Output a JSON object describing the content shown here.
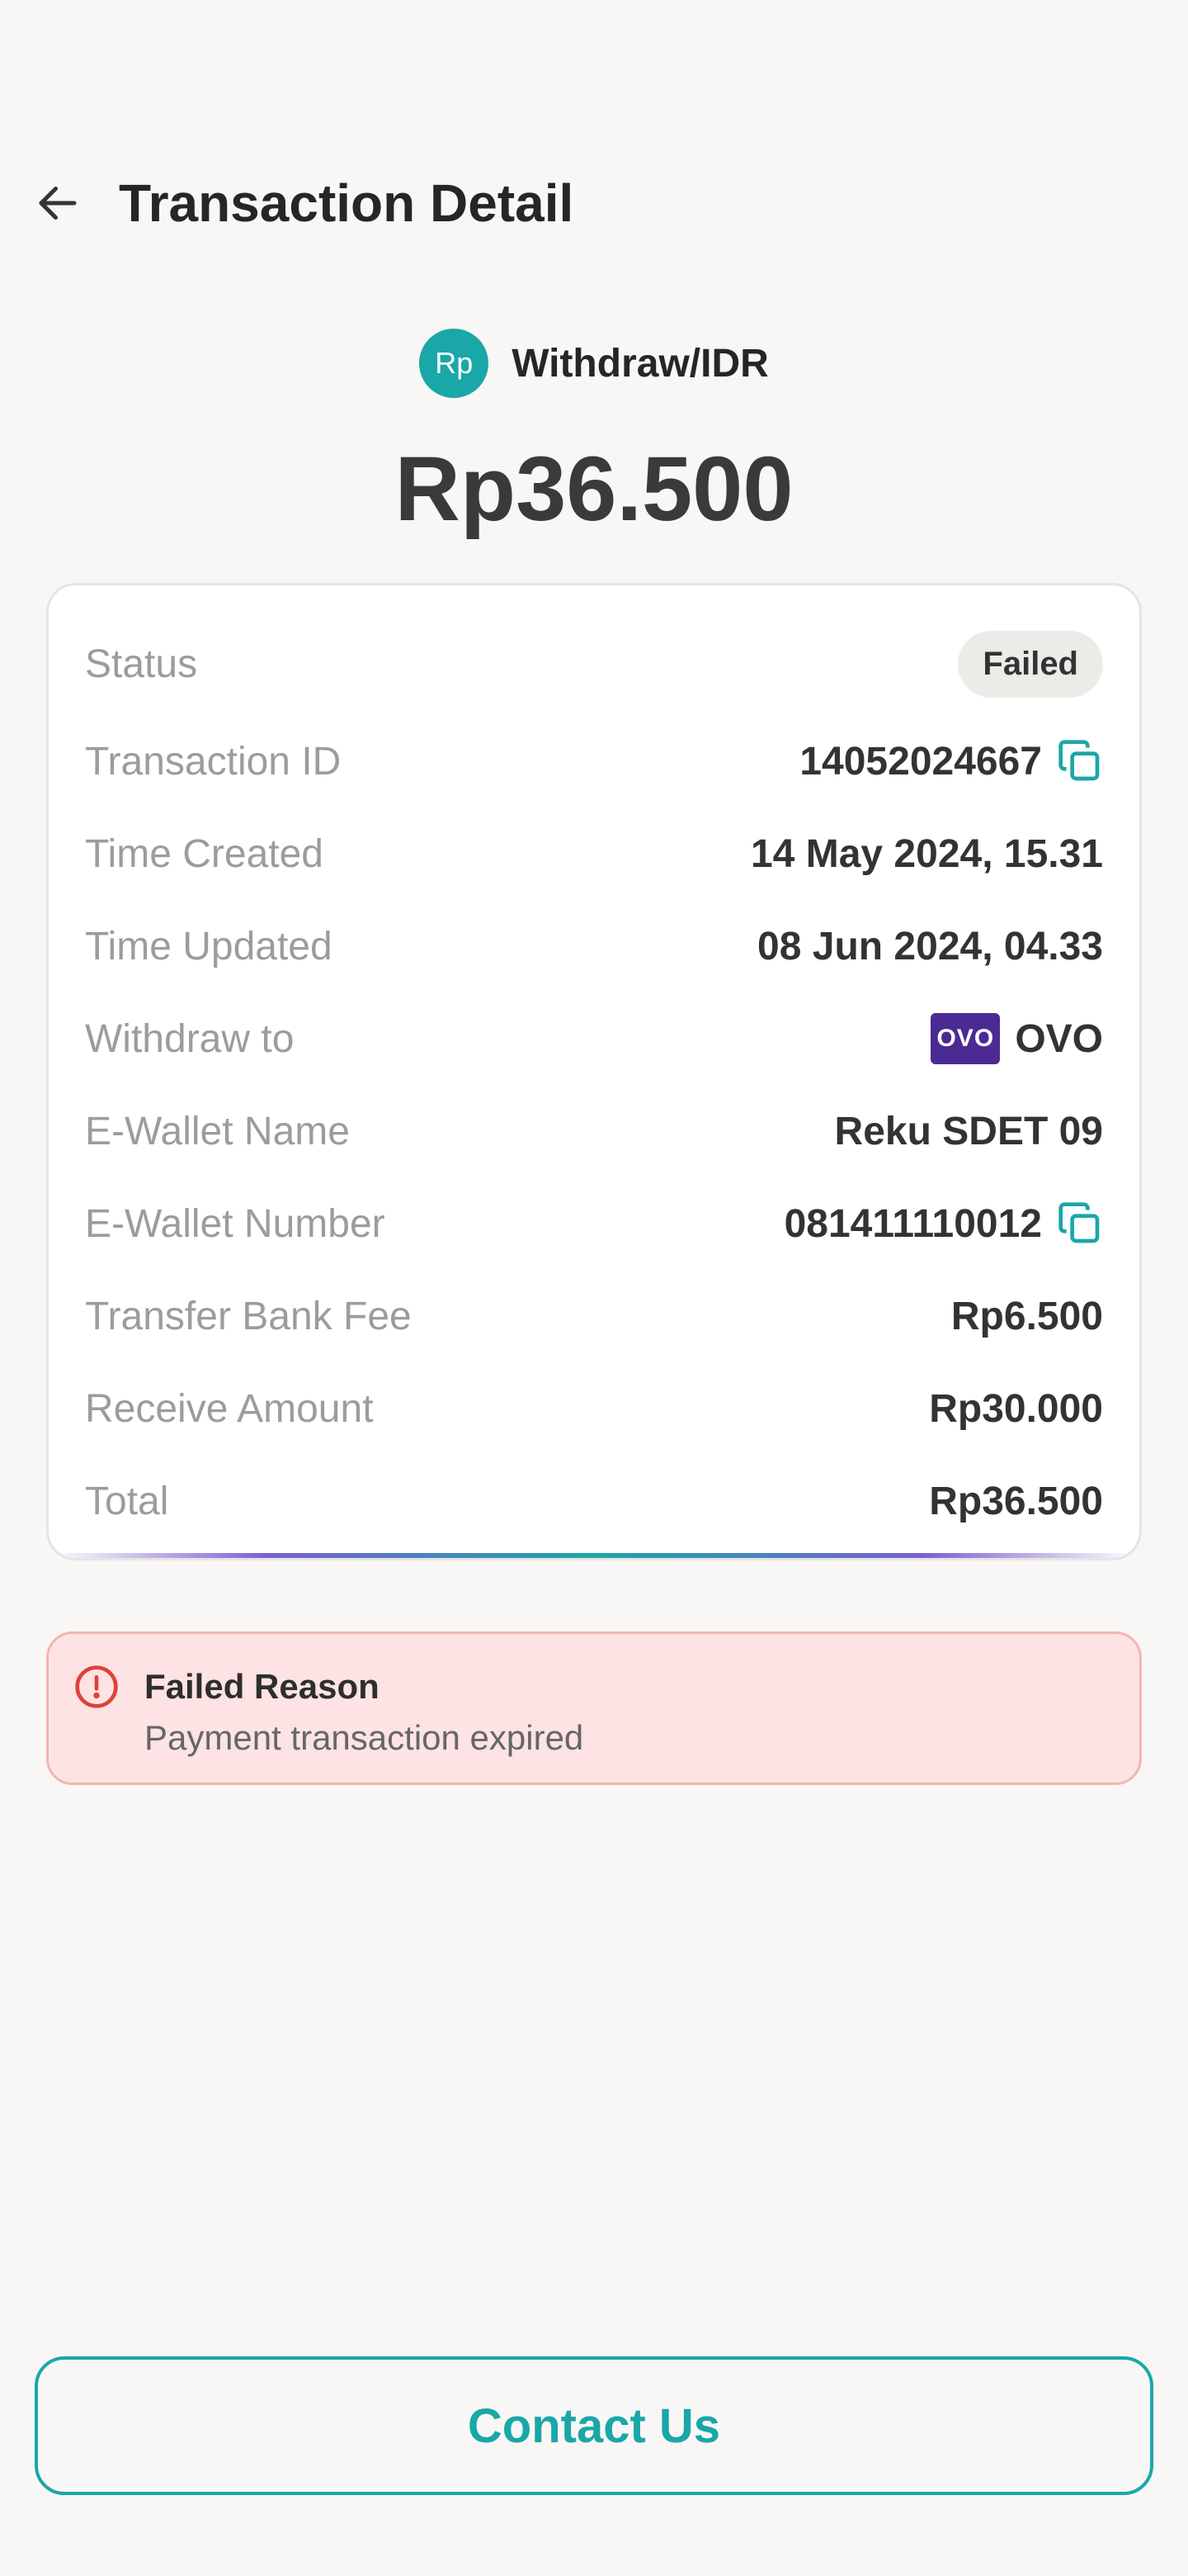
{
  "header": {
    "title": "Transaction Detail"
  },
  "asset": {
    "icon_text": "Rp",
    "name": "Withdraw/IDR"
  },
  "amount": "Rp36.500",
  "details": {
    "status_label": "Status",
    "status_value": "Failed",
    "txid_label": "Transaction ID",
    "txid_value": "14052024667",
    "created_label": "Time Created",
    "created_value": "14 May 2024, 15.31",
    "updated_label": "Time Updated",
    "updated_value": "08 Jun 2024, 04.33",
    "withdraw_label": "Withdraw to",
    "withdraw_logo": "OVO",
    "withdraw_value": "OVO",
    "wallet_name_label": "E-Wallet Name",
    "wallet_name_value": "Reku SDET 09",
    "wallet_number_label": "E-Wallet Number",
    "wallet_number_value": "081411110012",
    "fee_label": "Transfer Bank Fee",
    "fee_value": "Rp6.500",
    "receive_label": "Receive Amount",
    "receive_value": "Rp30.000",
    "total_label": "Total",
    "total_value": "Rp36.500"
  },
  "failed_reason": {
    "title": "Failed Reason",
    "text": "Payment transaction expired"
  },
  "contact_button": "Contact Us",
  "colors": {
    "accent": "#1aa7a8",
    "error": "#e0413b",
    "ovo": "#4c2a94"
  },
  "icons": {
    "back": "arrow-left-icon",
    "copy": "copy-icon",
    "alert": "alert-circle-icon"
  }
}
